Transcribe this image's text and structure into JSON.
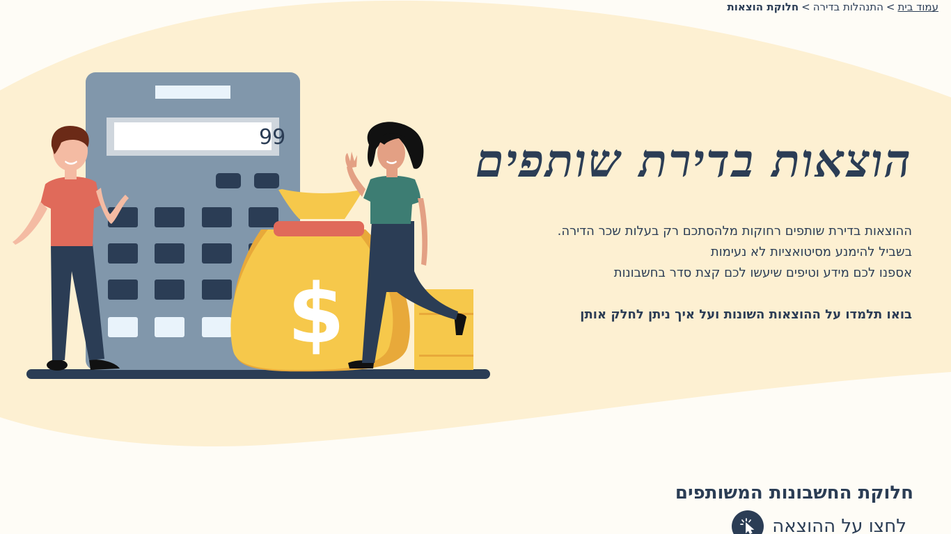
{
  "breadcrumb": {
    "home": "עמוד בית",
    "separator": ">",
    "parent": "התנהלות בדירה",
    "current": "חלוקת הוצאות"
  },
  "hero": {
    "title": "הוצאות בדירת שותפים",
    "lines": [
      "ההוצאות בדירת שותפים רחוקות מלהסתכם רק בעלות שכר הדירה.",
      "בשביל להימנע מסיטואציות לא נעימות",
      "אספנו לכם מידע וטיפים שיעשו לכם קצת סדר בחשבונות"
    ],
    "cta": "בואו תלמדו על ההוצאות השונות ועל איך ניתן לחלק אותן"
  },
  "illustration": {
    "calculator_display": "99",
    "money_symbol": "$"
  },
  "section": {
    "title": "חלוקת החשבונות המשותפים",
    "click_hint": "לחצו על ההוצאה",
    "click_icon": "pointer-click-icon"
  },
  "colors": {
    "blob": "#fdf0d2",
    "text": "#2b3d55",
    "calculator": "#8197ab",
    "bag": "#f6c84b",
    "bag_band": "#e06a5a",
    "background": "#fefcf6"
  }
}
